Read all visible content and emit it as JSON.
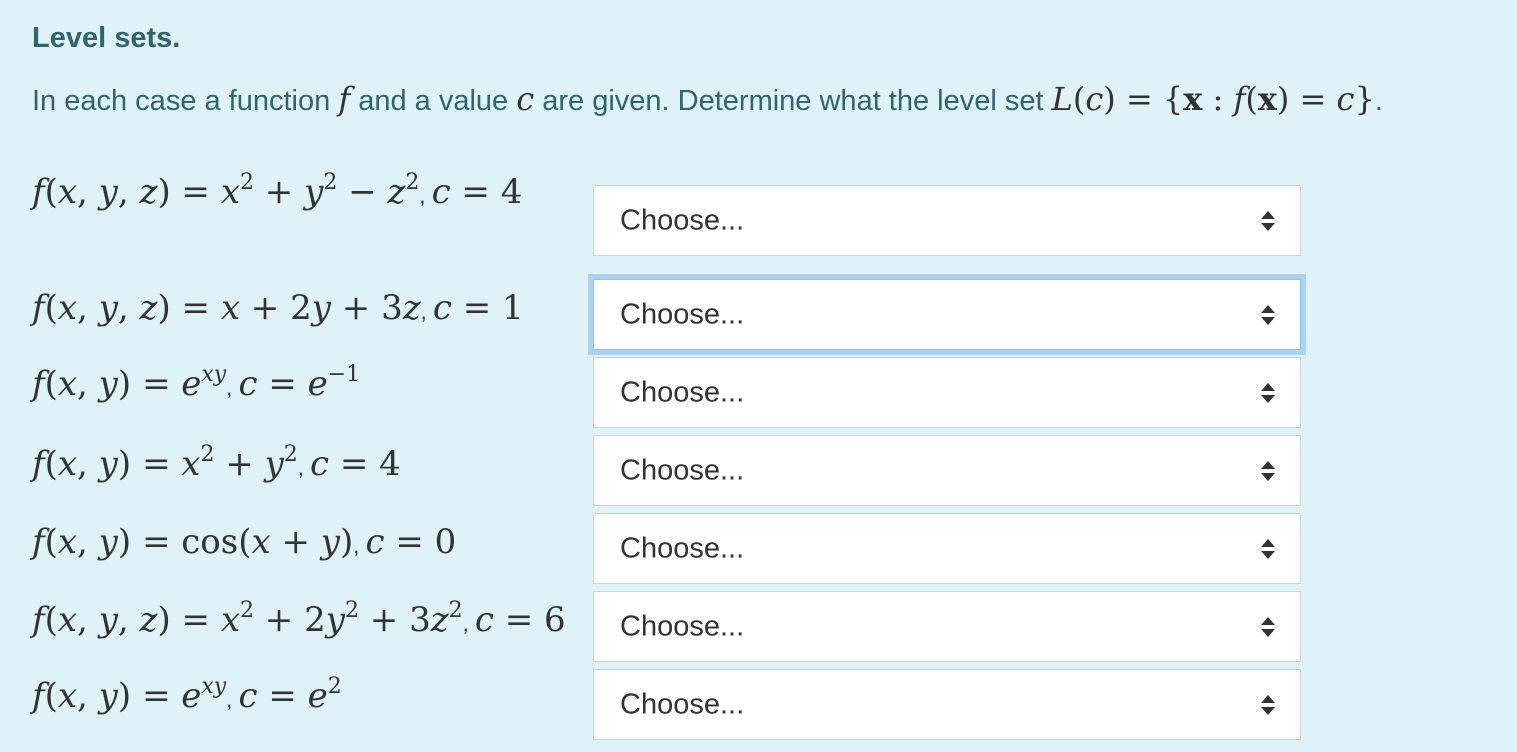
{
  "heading": "Level sets.",
  "instructions": {
    "part1": "In each case a function",
    "part2": "and a value",
    "part3": "are given. Determine what the level set",
    "end": "."
  },
  "select_placeholder": "Choose...",
  "questions": [
    {
      "id": 1,
      "formula": "f(x, y, z) = x² + y² − z², c = 4",
      "selected": "Choose...",
      "focused": false
    },
    {
      "id": 2,
      "formula": "f(x, y, z) = x + 2y + 3z, c = 1",
      "selected": "Choose...",
      "focused": true
    },
    {
      "id": 3,
      "formula": "f(x, y) = e^{xy}, c = e^{−1}",
      "selected": "Choose...",
      "focused": false
    },
    {
      "id": 4,
      "formula": "f(x, y) = x² + y², c = 4",
      "selected": "Choose...",
      "focused": false
    },
    {
      "id": 5,
      "formula": "f(x, y) = cos(x + y), c = 0",
      "selected": "Choose...",
      "focused": false
    },
    {
      "id": 6,
      "formula": "f(x, y, z) = x² + 2y² + 3z², c = 6",
      "selected": "Choose...",
      "focused": false
    },
    {
      "id": 7,
      "formula": "f(x, y) = e^{xy}, c = e²",
      "selected": "Choose...",
      "focused": false
    }
  ],
  "colors": {
    "background": "#def2f8",
    "text": "#2f6473",
    "focus_ring": "#a9d3ee"
  }
}
